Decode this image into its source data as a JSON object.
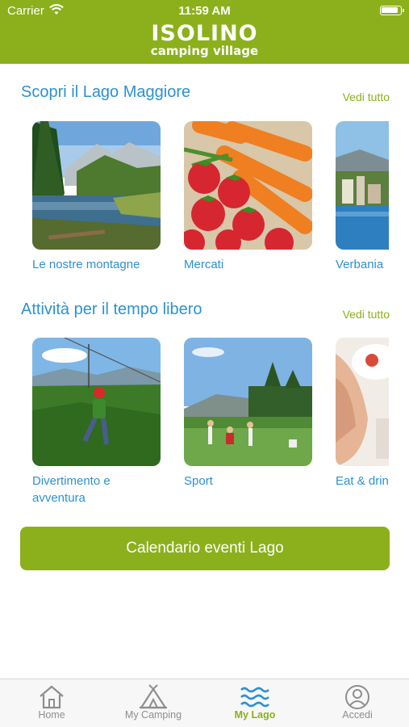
{
  "status_bar": {
    "carrier": "Carrier",
    "time": "11:59 AM"
  },
  "brand": {
    "line1": "ISOLINO",
    "line2": "camping village"
  },
  "sections": [
    {
      "title": "Scopri il Lago Maggiore",
      "see_all": "Vedi tutto",
      "cards": [
        {
          "label": "Le nostre montagne",
          "image": "mountain-lake-photo"
        },
        {
          "label": "Mercati",
          "image": "strawberries-carrots-photo"
        },
        {
          "label": "Verbania",
          "image": "lakeside-town-photo"
        }
      ]
    },
    {
      "title": "Attività per il tempo libero",
      "see_all": "Vedi tutto",
      "cards": [
        {
          "label_line1": "Divertimento e",
          "label_line2": "avventura",
          "image": "zipline-photo"
        },
        {
          "label": "Sport",
          "image": "golf-field-photo"
        },
        {
          "label": "Eat & drink",
          "image": "dining-photo"
        }
      ]
    }
  ],
  "calendar_button": "Calendario eventi Lago",
  "tabs": [
    {
      "label": "Home",
      "icon": "house-icon",
      "active": false
    },
    {
      "label": "My Camping",
      "icon": "tent-icon",
      "active": false
    },
    {
      "label": "My Lago",
      "icon": "waves-icon",
      "active": true
    },
    {
      "label": "Accedi",
      "icon": "person-icon",
      "active": false
    }
  ],
  "colors": {
    "brand_green": "#8bb01b",
    "title_blue": "#2d91d2",
    "tab_inactive": "#8e8e8e"
  }
}
